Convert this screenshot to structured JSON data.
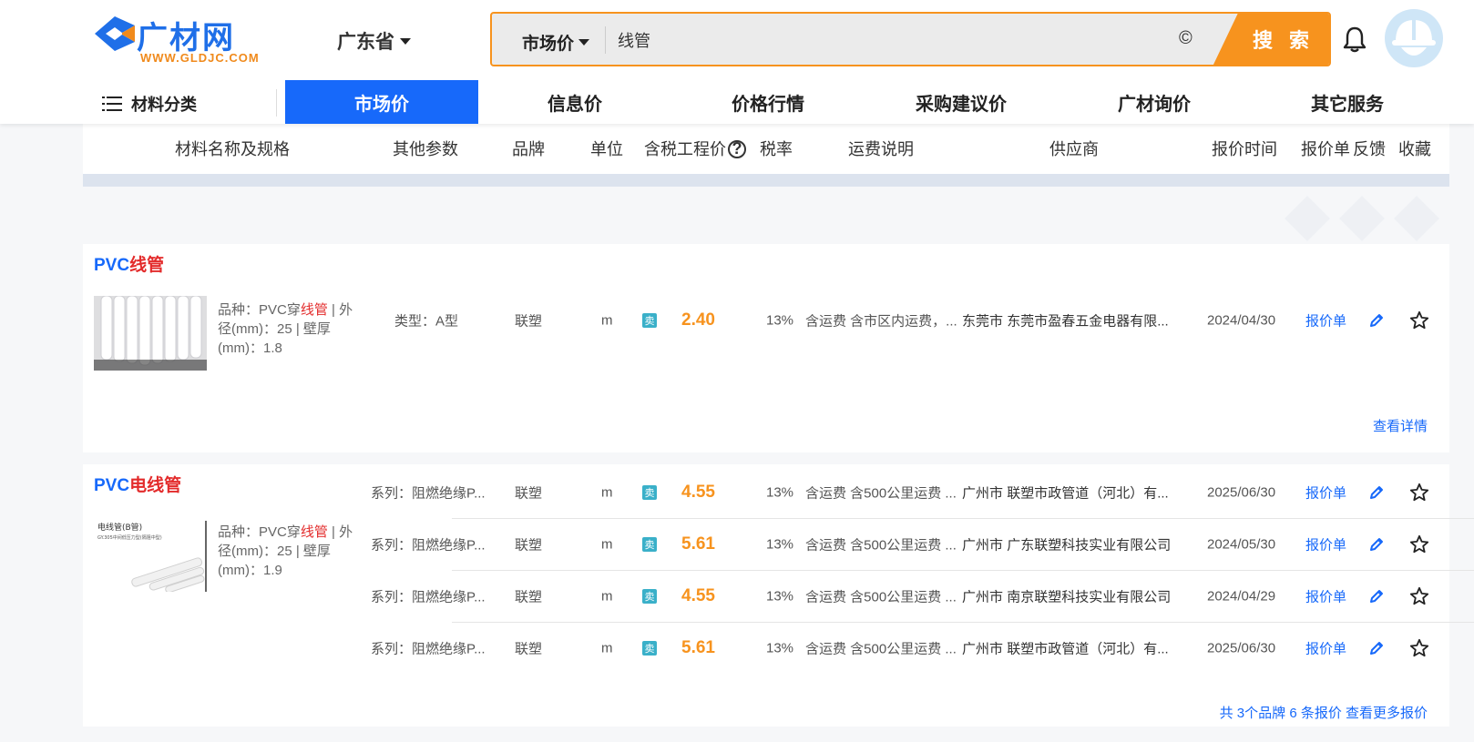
{
  "logo": {
    "name": "广材网",
    "url": "WWW.GLDJC.COM"
  },
  "region": "广东省",
  "search": {
    "category": "市场价",
    "query": "线管",
    "clear_icon": "©",
    "button": "搜 索"
  },
  "nav": {
    "category_menu": "材料分类",
    "tabs": [
      {
        "label": "市场价",
        "active": true
      },
      {
        "label": "信息价"
      },
      {
        "label": "价格行情"
      },
      {
        "label": "采购建议价"
      },
      {
        "label": "广材询价"
      },
      {
        "label": "其它服务"
      }
    ]
  },
  "columns": {
    "name": "材料名称及规格",
    "params": "其他参数",
    "brand": "品牌",
    "unit": "单位",
    "price": "含税工程价",
    "tax": "税率",
    "freight": "运费说明",
    "supplier": "供应商",
    "date": "报价时间",
    "quote": "报价单",
    "feedback": "反馈",
    "favorite": "收藏"
  },
  "products": [
    {
      "title_prefix": "PVC",
      "title_keyword": "线管",
      "spec_prefix": "品种：PVC穿",
      "spec_keyword": "线管",
      "spec_suffix": " | 外径(mm)：25 | 壁厚(mm)：1.8",
      "rows": [
        {
          "param": "类型：A型",
          "brand": "联塑",
          "unit": "m",
          "sell": "卖",
          "price": "2.40",
          "tax": "13%",
          "freight": "含运费 含市区内运费，...",
          "supplier_city": "东莞市",
          "supplier": "东莞市盈春五金电器有限...",
          "date": "2024/04/30",
          "quote": "报价单"
        }
      ],
      "more": "查看详情"
    },
    {
      "title_prefix": "PVC",
      "title_keyword": "电线管",
      "spec_prefix": "品种：PVC穿",
      "spec_keyword": "线管",
      "spec_suffix": " | 外径(mm)：25 | 壁厚(mm)：1.9",
      "thumb_label": "电线管(B管)",
      "thumb_sub": "GY.305中间低压力型(隔阻中型)",
      "rows": [
        {
          "param": "系列：阻燃绝缘P...",
          "brand": "联塑",
          "unit": "m",
          "sell": "卖",
          "price": "4.55",
          "tax": "13%",
          "freight": "含运费 含500公里运费 ...",
          "supplier_city": "广州市",
          "supplier": "联塑市政管道（河北）有...",
          "date": "2025/06/30",
          "quote": "报价单"
        },
        {
          "param": "系列：阻燃绝缘P...",
          "brand": "联塑",
          "unit": "m",
          "sell": "卖",
          "price": "5.61",
          "tax": "13%",
          "freight": "含运费 含500公里运费 ...",
          "supplier_city": "广州市",
          "supplier": "广东联塑科技实业有限公司",
          "date": "2024/05/30",
          "quote": "报价单"
        },
        {
          "param": "系列：阻燃绝缘P...",
          "brand": "联塑",
          "unit": "m",
          "sell": "卖",
          "price": "4.55",
          "tax": "13%",
          "freight": "含运费 含500公里运费 ...",
          "supplier_city": "广州市",
          "supplier": "南京联塑科技实业有限公司",
          "date": "2024/04/29",
          "quote": "报价单"
        },
        {
          "param": "系列：阻燃绝缘P...",
          "brand": "联塑",
          "unit": "m",
          "sell": "卖",
          "price": "5.61",
          "tax": "13%",
          "freight": "含运费 含500公里运费 ...",
          "supplier_city": "广州市",
          "supplier": "联塑市政管道（河北）有...",
          "date": "2025/06/30",
          "quote": "报价单"
        }
      ],
      "more": "共 3个品牌 6 条报价 查看更多报价"
    }
  ],
  "colors": {
    "brand_blue": "#1769fa",
    "accent_orange": "#f7931e",
    "keyword_red": "#e32b2b"
  }
}
